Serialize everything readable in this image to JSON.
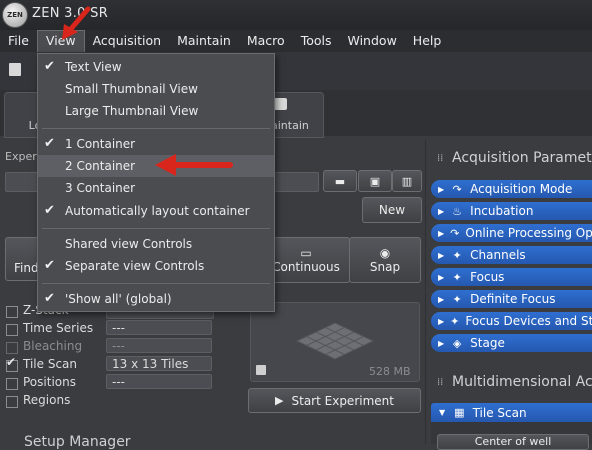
{
  "app": {
    "title": "ZEN 3.0 SR",
    "logo_text": "ZEN"
  },
  "menubar": [
    "File",
    "View",
    "Acquisition",
    "Maintain",
    "Macro",
    "Tools",
    "Window",
    "Help"
  ],
  "tabs": {
    "left_partial": "Lo",
    "right_partial": "aintain"
  },
  "view_menu": {
    "items": [
      {
        "label": "Text View",
        "checked": true
      },
      {
        "label": "Small Thumbnail View",
        "checked": false
      },
      {
        "label": "Large Thumbnail View",
        "checked": false
      },
      {
        "label": "1 Container",
        "checked": true
      },
      {
        "label": "2 Container",
        "checked": false,
        "highlighted": true
      },
      {
        "label": "3 Container",
        "checked": false
      },
      {
        "label": "Automatically layout container",
        "checked": true
      },
      {
        "label": "Shared view Controls",
        "checked": false
      },
      {
        "label": "Separate view Controls",
        "checked": true
      },
      {
        "label": "'Show all' (global)",
        "checked": true
      }
    ]
  },
  "left_panel": {
    "experiment_label_partial": "Exper",
    "new_button": "New",
    "find_partial": "Find",
    "continuous": "Continuous",
    "snap": "Snap",
    "dimensions": [
      {
        "label": "Z-Stack",
        "value": "",
        "checked": false,
        "dim": false
      },
      {
        "label": "Time Series",
        "value": "---",
        "checked": false,
        "dim": false
      },
      {
        "label": "Bleaching",
        "value": "---",
        "checked": false,
        "dim": true
      },
      {
        "label": "Tile Scan",
        "value": "13 x 13 Tiles",
        "checked": true,
        "dim": false
      },
      {
        "label": "Positions",
        "value": "---",
        "checked": false,
        "dim": false
      },
      {
        "label": "Regions",
        "value": "",
        "checked": false,
        "dim": false
      }
    ],
    "memory": "528 MB",
    "start_experiment": "Start Experiment",
    "setup_manager_partial": "Setup Manager"
  },
  "right_panel": {
    "acq_params_title": "Acquisition Paramete",
    "rows": [
      {
        "label": "Acquisition Mode",
        "icon": "↷"
      },
      {
        "label": "Incubation",
        "icon": "♨"
      },
      {
        "label": "Online Processing Opt",
        "icon": "↷"
      },
      {
        "label": "Channels",
        "icon": "✦"
      },
      {
        "label": "Focus",
        "icon": "✦"
      },
      {
        "label": "Definite Focus",
        "icon": "✦"
      },
      {
        "label": "Focus Devices and Stra",
        "icon": "✦"
      },
      {
        "label": "Stage",
        "icon": "◈"
      }
    ],
    "multidim_title": "Multidimensional Ac",
    "tile_scan_row": "Tile Scan",
    "bottom_partial": "Center of well"
  },
  "colors": {
    "accent_blue": "#2f6fd0",
    "arrow_red": "#d8261c",
    "menu_bg": "#4a4c50"
  }
}
